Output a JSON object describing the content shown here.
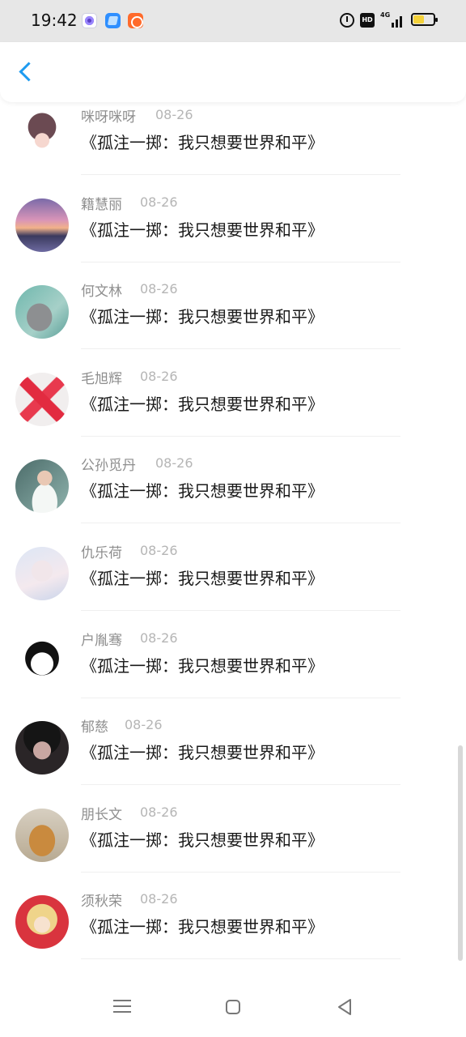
{
  "status_bar": {
    "time": "19:42",
    "icons": [
      "alarm-icon",
      "hd-icon",
      "4g-signal-icon",
      "battery-icon"
    ],
    "network": "4G",
    "battery_level": 0.55,
    "app_icons": [
      "purple-app-icon",
      "blue-app-icon",
      "orange-app-icon"
    ]
  },
  "header": {
    "back_icon": "chevron-left-icon",
    "accent_color": "#1e9bf0"
  },
  "list": {
    "items": [
      {
        "name": "咪呀咪呀",
        "date": "08-26",
        "content": "《孤注一掷：我只想要世界和平》",
        "avatar": "cartoon-girl-avatar"
      },
      {
        "name": "籍慧丽",
        "date": "08-26",
        "content": "《孤注一掷：我只想要世界和平》",
        "avatar": "sunset-pier-avatar"
      },
      {
        "name": "何文林",
        "date": "08-26",
        "content": "《孤注一掷：我只想要世界和平》",
        "avatar": "cat-avatar"
      },
      {
        "name": "毛旭辉",
        "date": "08-26",
        "content": "《孤注一掷：我只想要世界和平》",
        "avatar": "red-ribbon-avatar"
      },
      {
        "name": "公孙觅丹",
        "date": "08-26",
        "content": "《孤注一掷：我只想要世界和平》",
        "avatar": "boy-photo-avatar"
      },
      {
        "name": "仇乐荷",
        "date": "08-26",
        "content": "《孤注一掷：我只想要世界和平》",
        "avatar": "anime-boy-avatar"
      },
      {
        "name": "户胤骞",
        "date": "08-26",
        "content": "《孤注一掷：我只想要世界和平》",
        "avatar": "cartoon-face-avatar"
      },
      {
        "name": "郁慈",
        "date": "08-26",
        "content": "《孤注一掷：我只想要世界和平》",
        "avatar": "dark-portrait-avatar"
      },
      {
        "name": "朋长文",
        "date": "08-26",
        "content": "《孤注一掷：我只想要世界和平》",
        "avatar": "dog-avatar"
      },
      {
        "name": "须秋荣",
        "date": "08-26",
        "content": "《孤注一掷：我只想要世界和平》",
        "avatar": "anime-fox-girl-avatar"
      }
    ]
  },
  "nav_bar": {
    "icons": [
      "menu-icon",
      "home-icon",
      "back-triangle-icon"
    ]
  }
}
